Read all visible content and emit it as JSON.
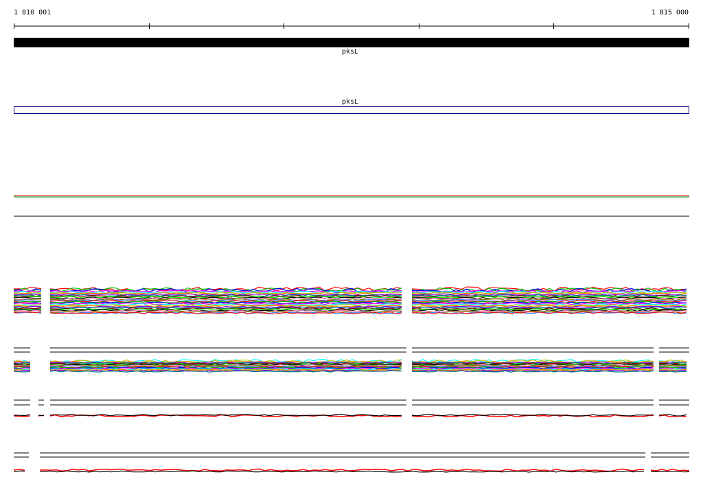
{
  "ruler": {
    "start_label": "1 810 001",
    "end_label": "1 815 000"
  },
  "gene_track": {
    "label": "pksL",
    "color": "#000000"
  },
  "cds_track": {
    "label": "pksL",
    "outline_color": "#000080"
  },
  "colors": {
    "trace_palette": [
      "#ff0000",
      "#00c000",
      "#0000ff",
      "#ff00ff",
      "#00ffff",
      "#c0c000",
      "#ff8000",
      "#8000ff",
      "#008080",
      "#800000",
      "#00ff00",
      "#000000",
      "#ff80c0",
      "#808000",
      "#4080ff"
    ],
    "line_dark": "#000000",
    "line_red": "#ff0000",
    "track_green": "#008000",
    "track_red": "#c00000"
  }
}
